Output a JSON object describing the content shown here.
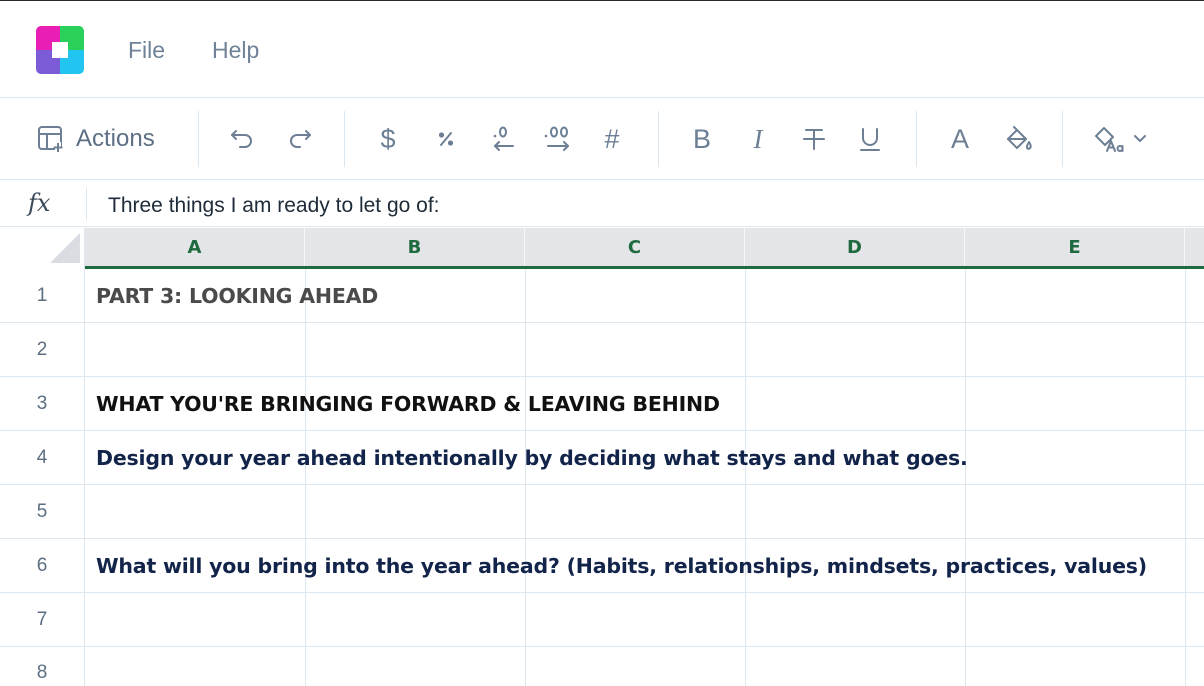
{
  "menu": {
    "file": "File",
    "help": "Help"
  },
  "toolbar": {
    "actions_label": "Actions",
    "currency_symbol": "$",
    "number_symbol": "#",
    "bold": "B",
    "italic": "I",
    "font_color": "A",
    "icons": [
      "table-add-icon",
      "undo-icon",
      "redo-icon",
      "currency-icon",
      "percent-icon",
      "decrease-decimal-icon",
      "increase-decimal-icon",
      "number-format-icon",
      "bold-icon",
      "italic-icon",
      "strikethrough-icon",
      "underline-icon",
      "font-color-icon",
      "fill-color-icon",
      "format-style-icon",
      "chevron-down-icon"
    ]
  },
  "formula_bar": {
    "label": "fx",
    "content": "Three things I am ready to let go of:"
  },
  "columns": [
    "A",
    "B",
    "C",
    "D",
    "E"
  ],
  "rows": [
    {
      "num": "1",
      "text": "PART 3: LOOKING AHEAD"
    },
    {
      "num": "2",
      "text": ""
    },
    {
      "num": "3",
      "text": "WHAT YOU'RE BRINGING FORWARD & LEAVING BEHIND"
    },
    {
      "num": "4",
      "text": "Design your year ahead intentionally by deciding what stays and what goes."
    },
    {
      "num": "5",
      "text": ""
    },
    {
      "num": "6",
      "text": "What will you bring into the year ahead? (Habits, relationships, mindsets, practices, values)"
    },
    {
      "num": "7",
      "text": ""
    },
    {
      "num": "8",
      "text": ""
    }
  ],
  "colors": {
    "accent_green": "#1f6b3f",
    "heading_gray": "#4a4a4a",
    "text_navy": "#13244a",
    "icon_gray": "#6c7f94"
  }
}
